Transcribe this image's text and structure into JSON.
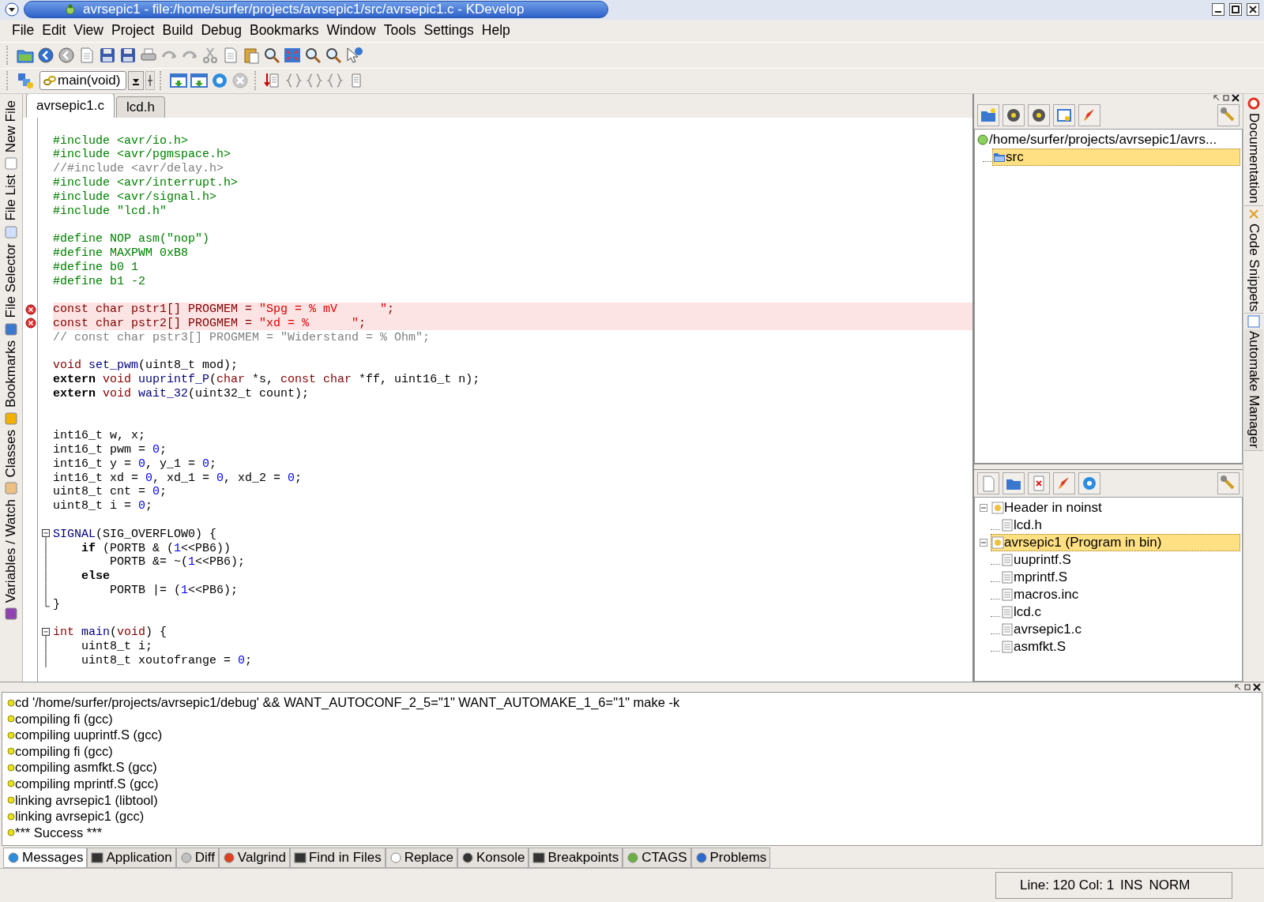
{
  "window": {
    "title": "avrsepic1 - file:/home/surfer/projects/avrsepic1/src/avrsepic1.c - KDevelop"
  },
  "menu": [
    "File",
    "Edit",
    "View",
    "Project",
    "Build",
    "Debug",
    "Bookmarks",
    "Window",
    "Tools",
    "Settings",
    "Help"
  ],
  "function_combo": {
    "value": "main(void)"
  },
  "left_tabs": [
    {
      "label": "New File",
      "selected": false
    },
    {
      "label": "File List",
      "selected": false
    },
    {
      "label": "File Selector",
      "selected": false
    },
    {
      "label": "Bookmarks",
      "selected": false
    },
    {
      "label": "Classes",
      "selected": false
    },
    {
      "label": "Variables / Watch",
      "selected": false
    }
  ],
  "editor_tabs": [
    {
      "label": "avrsepic1.c",
      "selected": true
    },
    {
      "label": "lcd.h",
      "selected": false
    }
  ],
  "code": [
    {
      "kind": "blank"
    },
    {
      "kind": "code",
      "tokens": [
        {
          "preproc": "#include <avr/io.h>"
        }
      ]
    },
    {
      "kind": "code",
      "tokens": [
        {
          "preproc": "#include <avr/pgmspace.h>"
        }
      ]
    },
    {
      "kind": "code",
      "tokens": [
        {
          "comment": "//#include <avr/delay.h>"
        }
      ]
    },
    {
      "kind": "code",
      "tokens": [
        {
          "preproc": "#include <avr/interrupt.h>"
        }
      ]
    },
    {
      "kind": "code",
      "tokens": [
        {
          "preproc": "#include <avr/signal.h>"
        }
      ]
    },
    {
      "kind": "code",
      "tokens": [
        {
          "preproc": "#include \"lcd.h\""
        }
      ]
    },
    {
      "kind": "blank"
    },
    {
      "kind": "code",
      "tokens": [
        {
          "preproc": "#define NOP asm(\"nop\")"
        }
      ]
    },
    {
      "kind": "code",
      "tokens": [
        {
          "preproc": "#define MAXPWM 0xB8"
        }
      ]
    },
    {
      "kind": "code",
      "tokens": [
        {
          "preproc": "#define b0 1"
        }
      ]
    },
    {
      "kind": "code",
      "tokens": [
        {
          "preproc": "#define b1 -2"
        }
      ]
    },
    {
      "kind": "blank"
    },
    {
      "kind": "code",
      "error": true,
      "tokens": [
        {
          "type": "const char"
        },
        {
          "plain": " pstr1[] PROGMEM = "
        },
        {
          "string": "\"Spg = % mV      \""
        },
        {
          "plain": ";"
        }
      ]
    },
    {
      "kind": "code",
      "error": true,
      "tokens": [
        {
          "type": "const char"
        },
        {
          "plain": " pstr2[] PROGMEM = "
        },
        {
          "string": "\"xd = %      \""
        },
        {
          "plain": ";"
        }
      ]
    },
    {
      "kind": "code",
      "tokens": [
        {
          "comment": "// const char pstr3[] PROGMEM = \"Widerstand = % Ohm\";"
        }
      ]
    },
    {
      "kind": "blank"
    },
    {
      "kind": "code",
      "tokens": [
        {
          "type": "void "
        },
        {
          "func": "set_pwm"
        },
        {
          "plain": "(uint8_t mod);"
        }
      ]
    },
    {
      "kind": "code",
      "tokens": [
        {
          "keyword": "extern "
        },
        {
          "type": "void "
        },
        {
          "func": "uuprintf_P"
        },
        {
          "plain": "("
        },
        {
          "type": "char"
        },
        {
          "plain": " *s, "
        },
        {
          "type": "const char"
        },
        {
          "plain": " *ff, uint16_t n);"
        }
      ]
    },
    {
      "kind": "code",
      "tokens": [
        {
          "keyword": "extern "
        },
        {
          "type": "void "
        },
        {
          "func": "wait_32"
        },
        {
          "plain": "(uint32_t count);"
        }
      ]
    },
    {
      "kind": "blank"
    },
    {
      "kind": "blank"
    },
    {
      "kind": "code",
      "tokens": [
        {
          "plain": "int16_t w, x;"
        }
      ]
    },
    {
      "kind": "code",
      "tokens": [
        {
          "plain": "int16_t pwm = "
        },
        {
          "number": "0"
        },
        {
          "plain": ";"
        }
      ]
    },
    {
      "kind": "code",
      "tokens": [
        {
          "plain": "int16_t y = "
        },
        {
          "number": "0"
        },
        {
          "plain": ", y_1 = "
        },
        {
          "number": "0"
        },
        {
          "plain": ";"
        }
      ]
    },
    {
      "kind": "code",
      "tokens": [
        {
          "plain": "int16_t xd = "
        },
        {
          "number": "0"
        },
        {
          "plain": ", xd_1 = "
        },
        {
          "number": "0"
        },
        {
          "plain": ", xd_2 = "
        },
        {
          "number": "0"
        },
        {
          "plain": ";"
        }
      ]
    },
    {
      "kind": "code",
      "tokens": [
        {
          "plain": "uint8_t cnt = "
        },
        {
          "number": "0"
        },
        {
          "plain": ";"
        }
      ]
    },
    {
      "kind": "code",
      "tokens": [
        {
          "plain": "uint8_t i = "
        },
        {
          "number": "0"
        },
        {
          "plain": ";"
        }
      ]
    },
    {
      "kind": "blank"
    },
    {
      "kind": "code",
      "fold_toggle": true,
      "tokens": [
        {
          "func": "SIGNAL"
        },
        {
          "plain": "(SIG_OVERFLOW0) {"
        }
      ]
    },
    {
      "kind": "code",
      "fold_line": true,
      "tokens": [
        {
          "keyword": "    if"
        },
        {
          "plain": " (PORTB & ("
        },
        {
          "number": "1"
        },
        {
          "plain": "<<PB6))"
        }
      ]
    },
    {
      "kind": "code",
      "fold_line": true,
      "tokens": [
        {
          "plain": "        PORTB &= ~("
        },
        {
          "number": "1"
        },
        {
          "plain": "<<PB6);"
        }
      ]
    },
    {
      "kind": "code",
      "fold_line": true,
      "tokens": [
        {
          "keyword": "    else"
        }
      ]
    },
    {
      "kind": "code",
      "fold_line": true,
      "tokens": [
        {
          "plain": "        PORTB |= ("
        },
        {
          "number": "1"
        },
        {
          "plain": "<<PB6);"
        }
      ]
    },
    {
      "kind": "code",
      "fold_end": true,
      "tokens": [
        {
          "plain": "}"
        }
      ]
    },
    {
      "kind": "blank"
    },
    {
      "kind": "code",
      "fold_toggle": true,
      "tokens": [
        {
          "type": "int "
        },
        {
          "func": "main"
        },
        {
          "plain": "("
        },
        {
          "type": "void"
        },
        {
          "plain": ") {"
        }
      ]
    },
    {
      "kind": "code",
      "fold_line": true,
      "tokens": [
        {
          "plain": "    uint8_t i;"
        }
      ]
    },
    {
      "kind": "code",
      "fold_line": true,
      "tokens": [
        {
          "plain": "    uint8_t xoutofrange = "
        },
        {
          "number": "0"
        },
        {
          "plain": ";"
        }
      ]
    }
  ],
  "project_tree": [
    {
      "label": "/home/surfer/projects/avrsepic1/avrs...",
      "selected": false,
      "children": [
        {
          "label": "src",
          "selected": true
        }
      ]
    }
  ],
  "target_tree": [
    {
      "label": "Header in noinst",
      "selected": false,
      "children": [
        {
          "label": "lcd.h",
          "selected": false
        }
      ]
    },
    {
      "label": "avrsepic1 (Program in bin)",
      "selected": true,
      "children": [
        {
          "label": "uuprintf.S",
          "selected": false
        },
        {
          "label": "mprintf.S",
          "selected": false
        },
        {
          "label": "macros.inc",
          "selected": false
        },
        {
          "label": "lcd.c",
          "selected": false
        },
        {
          "label": "avrsepic1.c",
          "selected": false
        },
        {
          "label": "asmfkt.S",
          "selected": false
        }
      ]
    }
  ],
  "right_tabs": [
    {
      "label": "Documentation",
      "selected": false
    },
    {
      "label": "Code Snippets",
      "selected": false
    },
    {
      "label": "Automake Manager",
      "selected": true
    }
  ],
  "messages": [
    "cd '/home/surfer/projects/avrsepic1/debug' && WANT_AUTOCONF_2_5=\"1\" WANT_AUTOMAKE_1_6=\"1\" make -k",
    "compiling fi (gcc)",
    "compiling uuprintf.S (gcc)",
    "compiling fi (gcc)",
    "compiling asmfkt.S (gcc)",
    "compiling mprintf.S (gcc)",
    "linking avrsepic1 (libtool)",
    "linking avrsepic1 (gcc)",
    "*** Success ***"
  ],
  "output_tabs": [
    {
      "label": "Messages",
      "selected": true
    },
    {
      "label": "Application",
      "selected": false
    },
    {
      "label": "Diff",
      "selected": false
    },
    {
      "label": "Valgrind",
      "selected": false
    },
    {
      "label": "Find in Files",
      "selected": false
    },
    {
      "label": "Replace",
      "selected": false
    },
    {
      "label": "Konsole",
      "selected": false
    },
    {
      "label": "Breakpoints",
      "selected": false
    },
    {
      "label": "CTAGS",
      "selected": false
    },
    {
      "label": "Problems",
      "selected": false
    }
  ],
  "status_bar": [
    "Line: 120 Col: 1",
    "INS",
    "NORM"
  ]
}
